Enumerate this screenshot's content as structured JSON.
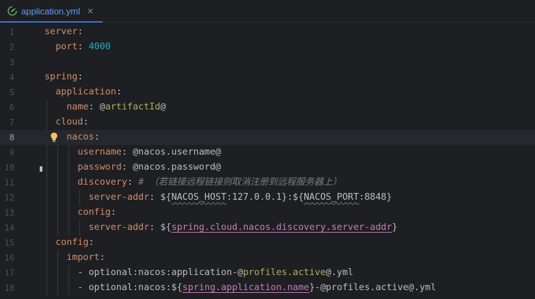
{
  "tab": {
    "label": "application.yml",
    "close": "×"
  },
  "lines": [
    {
      "num": "1",
      "text": "server:"
    },
    {
      "num": "2",
      "text": "  port: 4000"
    },
    {
      "num": "3",
      "text": ""
    },
    {
      "num": "4",
      "text": "spring:"
    },
    {
      "num": "5",
      "text": "  application:"
    },
    {
      "num": "6",
      "text": "    name: @artifactId@"
    },
    {
      "num": "7",
      "text": "  cloud:"
    },
    {
      "num": "8",
      "text": "    nacos:"
    },
    {
      "num": "9",
      "text": "      username: @nacos.username@"
    },
    {
      "num": "10",
      "text": "      password: @nacos.password@"
    },
    {
      "num": "11",
      "text": "      discovery: #（若链接远程链接则取消注册到远程服务器上）"
    },
    {
      "num": "12",
      "text": "        server-addr: ${NACOS_HOST:127.0.0.1}:${NACOS_PORT:8848}"
    },
    {
      "num": "13",
      "text": "      config:"
    },
    {
      "num": "14",
      "text": "        server-addr: ${spring.cloud.nacos.discovery.server-addr}"
    },
    {
      "num": "15",
      "text": "  config:"
    },
    {
      "num": "16",
      "text": "    import:"
    },
    {
      "num": "17",
      "text": "      - optional:nacos:application-@profiles.active@.yml"
    },
    {
      "num": "18",
      "text": "      - optional:nacos:${spring.application.name}-@profiles.active@.yml"
    }
  ],
  "current_line": "8",
  "colors": {
    "key": "#cf8e6d",
    "number": "#2aacb8",
    "comment": "#7a7e85",
    "accent": "#3574f0"
  }
}
